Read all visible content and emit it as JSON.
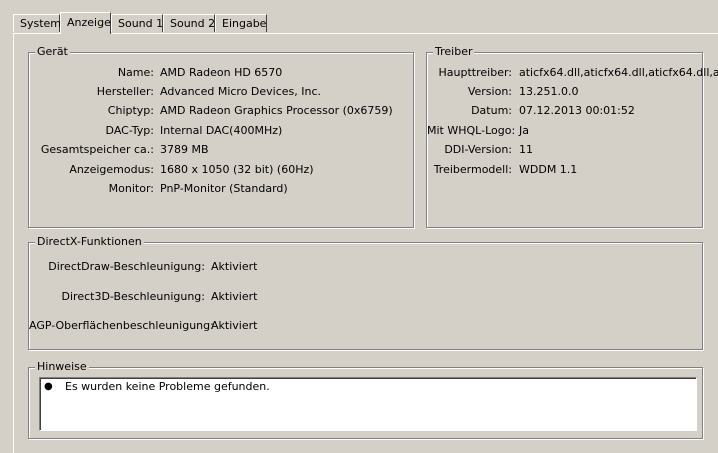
{
  "tabs": [
    {
      "label": "System"
    },
    {
      "label": "Anzeige"
    },
    {
      "label": "Sound 1"
    },
    {
      "label": "Sound 2"
    },
    {
      "label": "Eingabe"
    }
  ],
  "device": {
    "legend": "Gerät",
    "rows": [
      {
        "label": "Name:",
        "value": "AMD Radeon HD 6570"
      },
      {
        "label": "Hersteller:",
        "value": "Advanced Micro Devices, Inc."
      },
      {
        "label": "Chiptyp:",
        "value": "AMD Radeon Graphics Processor (0x6759)"
      },
      {
        "label": "DAC-Typ:",
        "value": "Internal DAC(400MHz)"
      },
      {
        "label": "Gesamtspeicher ca.:",
        "value": "3789 MB"
      },
      {
        "label": "Anzeigemodus:",
        "value": "1680 x 1050 (32 bit) (60Hz)"
      },
      {
        "label": "Monitor:",
        "value": "PnP-Monitor (Standard)"
      }
    ]
  },
  "driver": {
    "legend": "Treiber",
    "rows": [
      {
        "label": "Haupttreiber:",
        "value": "aticfx64.dll,aticfx64.dll,aticfx64.dll,a"
      },
      {
        "label": "Version:",
        "value": "13.251.0.0"
      },
      {
        "label": "Datum:",
        "value": "07.12.2013 00:01:52"
      },
      {
        "label": "Mit WHQL-Logo:",
        "value": "Ja"
      },
      {
        "label": "DDI-Version:",
        "value": "11"
      },
      {
        "label": "Treibermodell:",
        "value": "WDDM 1.1"
      }
    ]
  },
  "directx": {
    "legend": "DirectX-Funktionen",
    "rows": [
      {
        "label": "DirectDraw-Beschleunigung:",
        "value": "Aktiviert"
      },
      {
        "label": "Direct3D-Beschleunigung:",
        "value": "Aktiviert"
      },
      {
        "label": "AGP-Oberflächenbeschleunigung:",
        "value": "Aktiviert"
      }
    ]
  },
  "notes": {
    "legend": "Hinweise",
    "items": [
      "Es wurden keine Probleme gefunden."
    ]
  }
}
